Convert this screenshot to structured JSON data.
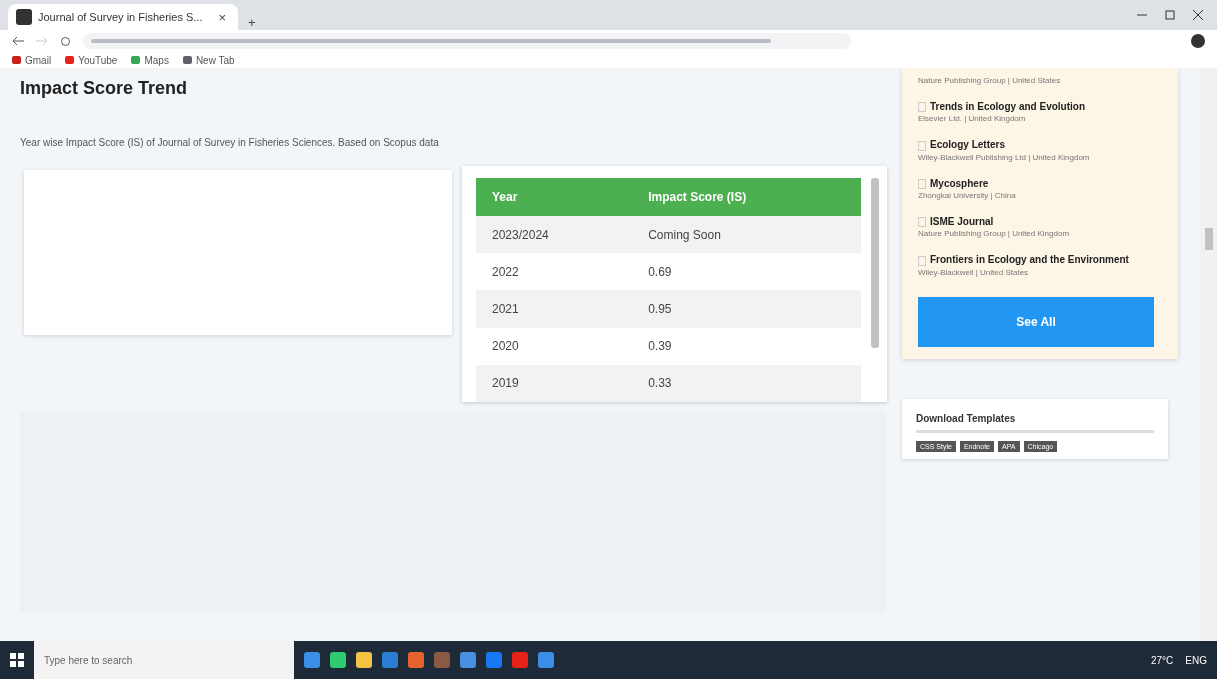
{
  "browser": {
    "tab_title": "Journal of Survey in Fisheries S...",
    "tab_close": "×",
    "new_tab": "+",
    "bookmarks": [
      {
        "label": "Gmail",
        "color": "#c5221f"
      },
      {
        "label": "YouTube",
        "color": "#e62117"
      },
      {
        "label": "Maps",
        "color": "#34a853"
      },
      {
        "label": "New Tab",
        "color": "#5f6368"
      }
    ]
  },
  "main": {
    "title": "Impact Score Trend",
    "description": "Year wise Impact Score (IS) of Journal of Survey in Fisheries Sciences. Based on Scopus data",
    "table": {
      "columns": [
        "Year",
        "Impact Score (IS)"
      ],
      "rows": [
        {
          "cells": [
            "2023/2024",
            "Coming Soon"
          ]
        },
        {
          "cells": [
            "2022",
            "0.69"
          ]
        },
        {
          "cells": [
            "2021",
            "0.95"
          ]
        },
        {
          "cells": [
            "2020",
            "0.39"
          ]
        },
        {
          "cells": [
            "2019",
            "0.33"
          ]
        }
      ]
    }
  },
  "sidebar": {
    "first_publisher": "Nature Publishing Group | United States",
    "journals": [
      {
        "name": "Trends in Ecology and Evolution",
        "publisher": "Elsevier Ltd. | United Kingdom"
      },
      {
        "name": "Ecology Letters",
        "publisher": "Wiley-Blackwell Publishing Ltd | United Kingdom"
      },
      {
        "name": "Mycosphere",
        "publisher": "Zhongkai University | China"
      },
      {
        "name": "ISME Journal",
        "publisher": "Nature Publishing Group | United Kingdom"
      },
      {
        "name": "Frontiers in Ecology and the Environment",
        "publisher": "Wiley-Blackwell | United States"
      }
    ],
    "see_all": "See All",
    "templates_title": "Download Templates",
    "templates": [
      "CSS Style",
      "Endnote",
      "APA",
      "Chicago"
    ]
  },
  "taskbar": {
    "search_placeholder": "Type here to search",
    "weather": "27°C",
    "language": "ENG"
  }
}
